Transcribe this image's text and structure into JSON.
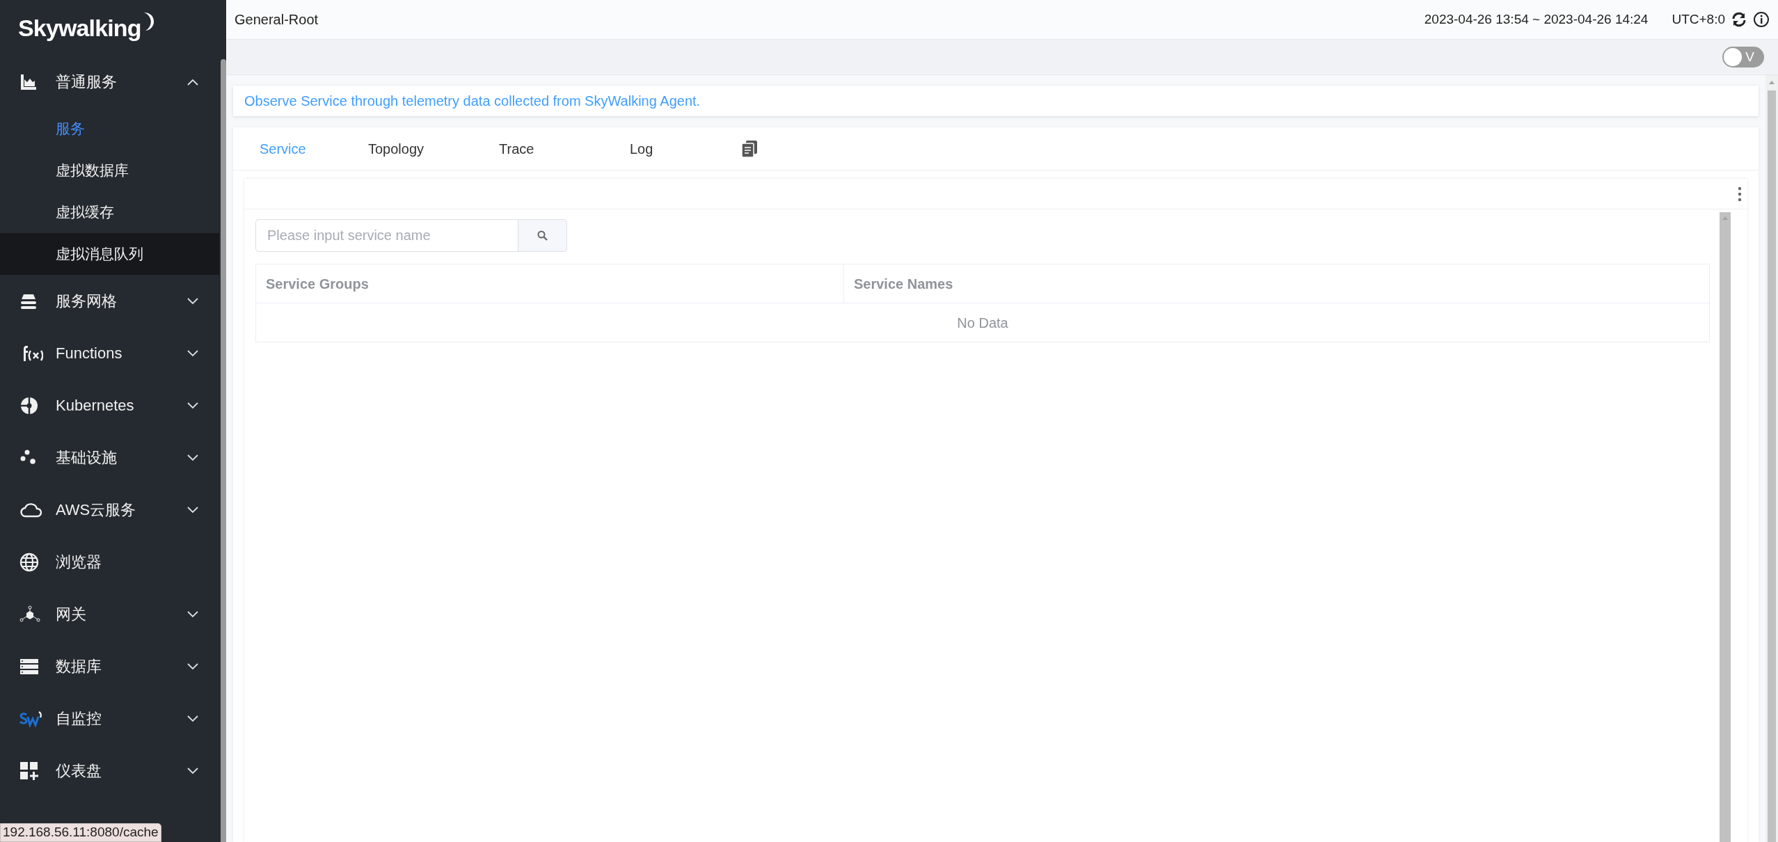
{
  "logo": {
    "text": "Skywalking"
  },
  "sidebar": {
    "items": [
      {
        "label": "普通服务",
        "kind": "group",
        "expanded": true,
        "children": [
          {
            "label": "服务",
            "selected": true,
            "hovered": false
          },
          {
            "label": "虚拟数据库",
            "selected": false,
            "hovered": false
          },
          {
            "label": "虚拟缓存",
            "selected": false,
            "hovered": false
          },
          {
            "label": "虚拟消息队列",
            "selected": false,
            "hovered": true
          }
        ]
      },
      {
        "label": "服务网格",
        "kind": "group",
        "expanded": false
      },
      {
        "label": "Functions",
        "kind": "group",
        "expanded": false
      },
      {
        "label": "Kubernetes",
        "kind": "group",
        "expanded": false
      },
      {
        "label": "基础设施",
        "kind": "group",
        "expanded": false
      },
      {
        "label": "AWS云服务",
        "kind": "group",
        "expanded": false
      },
      {
        "label": "浏览器",
        "kind": "link"
      },
      {
        "label": "网关",
        "kind": "group",
        "expanded": false
      },
      {
        "label": "数据库",
        "kind": "group",
        "expanded": false
      },
      {
        "label": "自监控",
        "kind": "group",
        "expanded": false
      },
      {
        "label": "仪表盘",
        "kind": "group",
        "expanded": false
      }
    ]
  },
  "header": {
    "title": "General-Root",
    "time_range": "2023-04-26 13:54 ~ 2023-04-26 14:24",
    "timezone": "UTC+8:0"
  },
  "toggle": {
    "label": "V",
    "on": false
  },
  "description": "Observe Service through telemetry data collected from SkyWalking Agent.",
  "tabs": [
    {
      "label": "Service",
      "selected": true
    },
    {
      "label": "Topology",
      "selected": false
    },
    {
      "label": "Trace",
      "selected": false
    },
    {
      "label": "Log",
      "selected": false
    }
  ],
  "search": {
    "placeholder": "Please input service name"
  },
  "table": {
    "columns": [
      "Service Groups",
      "Service Names"
    ],
    "empty_text": "No Data"
  },
  "status_url": "192.168.56.11:8080/cache"
}
